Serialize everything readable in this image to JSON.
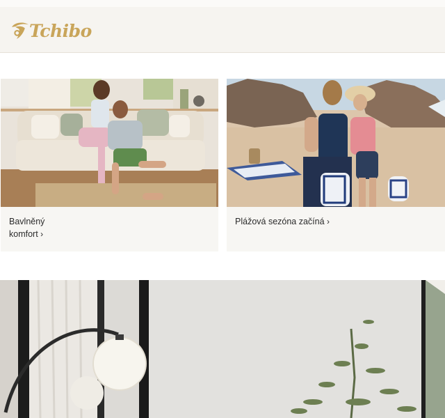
{
  "header": {
    "logo_text": "Tchibo",
    "brand_color": "#c9a55a",
    "background": "#f6f4f0"
  },
  "tiles": [
    {
      "caption_line1": "Bavlněný",
      "caption_line2": "komfort",
      "chevron": "›"
    },
    {
      "caption_line1": "Plážová sezóna začíná",
      "chevron": "›"
    }
  ],
  "icons": {
    "logo_mark": "tchibo-bean-icon",
    "chevron": "chevron-right-icon"
  }
}
